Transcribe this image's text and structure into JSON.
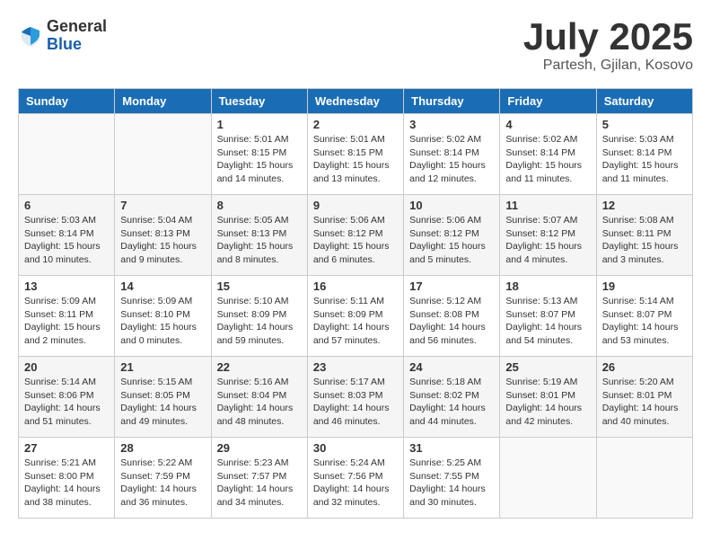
{
  "logo": {
    "general": "General",
    "blue": "Blue"
  },
  "title": "July 2025",
  "location": "Partesh, Gjilan, Kosovo",
  "days_of_week": [
    "Sunday",
    "Monday",
    "Tuesday",
    "Wednesday",
    "Thursday",
    "Friday",
    "Saturday"
  ],
  "weeks": [
    [
      {
        "day": "",
        "details": ""
      },
      {
        "day": "",
        "details": ""
      },
      {
        "day": "1",
        "details": "Sunrise: 5:01 AM\nSunset: 8:15 PM\nDaylight: 15 hours\nand 14 minutes."
      },
      {
        "day": "2",
        "details": "Sunrise: 5:01 AM\nSunset: 8:15 PM\nDaylight: 15 hours\nand 13 minutes."
      },
      {
        "day": "3",
        "details": "Sunrise: 5:02 AM\nSunset: 8:14 PM\nDaylight: 15 hours\nand 12 minutes."
      },
      {
        "day": "4",
        "details": "Sunrise: 5:02 AM\nSunset: 8:14 PM\nDaylight: 15 hours\nand 11 minutes."
      },
      {
        "day": "5",
        "details": "Sunrise: 5:03 AM\nSunset: 8:14 PM\nDaylight: 15 hours\nand 11 minutes."
      }
    ],
    [
      {
        "day": "6",
        "details": "Sunrise: 5:03 AM\nSunset: 8:14 PM\nDaylight: 15 hours\nand 10 minutes."
      },
      {
        "day": "7",
        "details": "Sunrise: 5:04 AM\nSunset: 8:13 PM\nDaylight: 15 hours\nand 9 minutes."
      },
      {
        "day": "8",
        "details": "Sunrise: 5:05 AM\nSunset: 8:13 PM\nDaylight: 15 hours\nand 8 minutes."
      },
      {
        "day": "9",
        "details": "Sunrise: 5:06 AM\nSunset: 8:12 PM\nDaylight: 15 hours\nand 6 minutes."
      },
      {
        "day": "10",
        "details": "Sunrise: 5:06 AM\nSunset: 8:12 PM\nDaylight: 15 hours\nand 5 minutes."
      },
      {
        "day": "11",
        "details": "Sunrise: 5:07 AM\nSunset: 8:12 PM\nDaylight: 15 hours\nand 4 minutes."
      },
      {
        "day": "12",
        "details": "Sunrise: 5:08 AM\nSunset: 8:11 PM\nDaylight: 15 hours\nand 3 minutes."
      }
    ],
    [
      {
        "day": "13",
        "details": "Sunrise: 5:09 AM\nSunset: 8:11 PM\nDaylight: 15 hours\nand 2 minutes."
      },
      {
        "day": "14",
        "details": "Sunrise: 5:09 AM\nSunset: 8:10 PM\nDaylight: 15 hours\nand 0 minutes."
      },
      {
        "day": "15",
        "details": "Sunrise: 5:10 AM\nSunset: 8:09 PM\nDaylight: 14 hours\nand 59 minutes."
      },
      {
        "day": "16",
        "details": "Sunrise: 5:11 AM\nSunset: 8:09 PM\nDaylight: 14 hours\nand 57 minutes."
      },
      {
        "day": "17",
        "details": "Sunrise: 5:12 AM\nSunset: 8:08 PM\nDaylight: 14 hours\nand 56 minutes."
      },
      {
        "day": "18",
        "details": "Sunrise: 5:13 AM\nSunset: 8:07 PM\nDaylight: 14 hours\nand 54 minutes."
      },
      {
        "day": "19",
        "details": "Sunrise: 5:14 AM\nSunset: 8:07 PM\nDaylight: 14 hours\nand 53 minutes."
      }
    ],
    [
      {
        "day": "20",
        "details": "Sunrise: 5:14 AM\nSunset: 8:06 PM\nDaylight: 14 hours\nand 51 minutes."
      },
      {
        "day": "21",
        "details": "Sunrise: 5:15 AM\nSunset: 8:05 PM\nDaylight: 14 hours\nand 49 minutes."
      },
      {
        "day": "22",
        "details": "Sunrise: 5:16 AM\nSunset: 8:04 PM\nDaylight: 14 hours\nand 48 minutes."
      },
      {
        "day": "23",
        "details": "Sunrise: 5:17 AM\nSunset: 8:03 PM\nDaylight: 14 hours\nand 46 minutes."
      },
      {
        "day": "24",
        "details": "Sunrise: 5:18 AM\nSunset: 8:02 PM\nDaylight: 14 hours\nand 44 minutes."
      },
      {
        "day": "25",
        "details": "Sunrise: 5:19 AM\nSunset: 8:01 PM\nDaylight: 14 hours\nand 42 minutes."
      },
      {
        "day": "26",
        "details": "Sunrise: 5:20 AM\nSunset: 8:01 PM\nDaylight: 14 hours\nand 40 minutes."
      }
    ],
    [
      {
        "day": "27",
        "details": "Sunrise: 5:21 AM\nSunset: 8:00 PM\nDaylight: 14 hours\nand 38 minutes."
      },
      {
        "day": "28",
        "details": "Sunrise: 5:22 AM\nSunset: 7:59 PM\nDaylight: 14 hours\nand 36 minutes."
      },
      {
        "day": "29",
        "details": "Sunrise: 5:23 AM\nSunset: 7:57 PM\nDaylight: 14 hours\nand 34 minutes."
      },
      {
        "day": "30",
        "details": "Sunrise: 5:24 AM\nSunset: 7:56 PM\nDaylight: 14 hours\nand 32 minutes."
      },
      {
        "day": "31",
        "details": "Sunrise: 5:25 AM\nSunset: 7:55 PM\nDaylight: 14 hours\nand 30 minutes."
      },
      {
        "day": "",
        "details": ""
      },
      {
        "day": "",
        "details": ""
      }
    ]
  ]
}
